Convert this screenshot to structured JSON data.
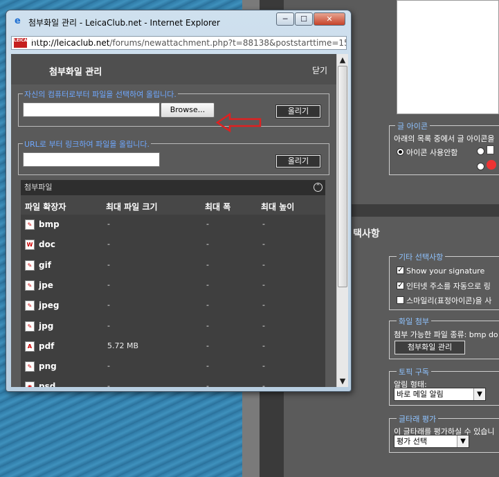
{
  "window": {
    "title": "첨부화일 관리 - LeicaClub.net - Internet Explorer",
    "address_domain": "http://leicaclub.net",
    "address_path": "/forums/newattachment.php?t=88138&poststarttime=1500718250",
    "minimize": "─",
    "maximize": "☐",
    "close": "✕",
    "site_icon_text": "LEICA CLUB"
  },
  "attach_manager": {
    "title": "첨부화일 관리",
    "close_link": "닫기",
    "upload_local_legend": "자신의 컴퓨터로부터 파일을 선택하여 올립니다.",
    "browse_label": "Browse...",
    "upload_label": "올리기",
    "upload_url_legend": "URL로 부터 링크하여 파일을 올립니다.",
    "upload_url_label": "올리기",
    "attachments_header": "첨부파일",
    "columns": [
      "파일 확장자",
      "최대 파일 크기",
      "최대 폭",
      "최대 높이"
    ],
    "files": [
      {
        "ext": "bmp",
        "size": "-",
        "width": "-",
        "height": "-",
        "icon": "image-file-icon"
      },
      {
        "ext": "doc",
        "size": "-",
        "width": "-",
        "height": "-",
        "icon": "word-file-icon"
      },
      {
        "ext": "gif",
        "size": "-",
        "width": "-",
        "height": "-",
        "icon": "image-file-icon"
      },
      {
        "ext": "jpe",
        "size": "-",
        "width": "-",
        "height": "-",
        "icon": "image-file-icon"
      },
      {
        "ext": "jpeg",
        "size": "-",
        "width": "-",
        "height": "-",
        "icon": "image-file-icon"
      },
      {
        "ext": "jpg",
        "size": "-",
        "width": "-",
        "height": "-",
        "icon": "image-file-icon"
      },
      {
        "ext": "pdf",
        "size": "5.72 MB",
        "width": "-",
        "height": "-",
        "icon": "pdf-file-icon"
      },
      {
        "ext": "png",
        "size": "-",
        "width": "-",
        "height": "-",
        "icon": "image-file-icon"
      },
      {
        "ext": "psd",
        "size": "-",
        "width": "-",
        "height": "-",
        "icon": "psd-file-icon"
      }
    ]
  },
  "background_page": {
    "post_icon_legend": "글 아이콘",
    "post_icon_desc": "아래의 목록 중에서 글 아이콘을",
    "no_icon_label": "아이콘 사용안함",
    "section_title": "택사항",
    "misc_legend": "기타 선택사항",
    "opt_signature": "Show your signature",
    "opt_autolink": "인터넷 주소를 자동으로 링",
    "opt_smilies": "스마일리(표정아이콘)을 사",
    "attach_legend": "화일 첨부",
    "attach_types": "첨부 가능한 파일 종류: bmp do",
    "attach_button": "첨부화일 관리",
    "subscribe_legend": "토픽 구독",
    "notify_label": "알림 형태:",
    "notify_value": "바로 메일 알림",
    "rating_legend": "글타래 평가",
    "rating_desc": "이 글타래를 평가하실 수 있습니",
    "rating_value": "평가 선택"
  },
  "colors": {
    "annotation_arrow": "#e02020",
    "legend_blue": "#6fa8ff"
  }
}
